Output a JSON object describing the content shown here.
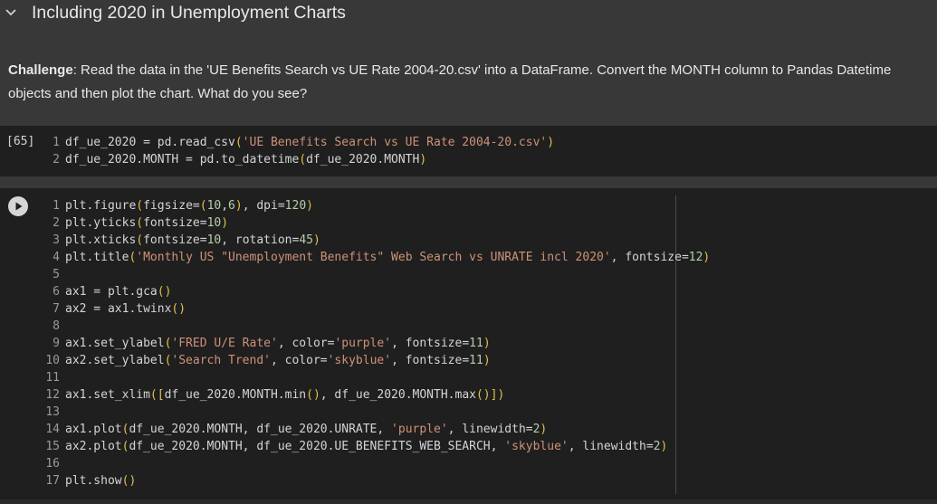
{
  "section": {
    "title": "Including 2020 in Unemployment Charts"
  },
  "markdown": {
    "bold": "Challenge",
    "text": ": Read the data in the 'UE Benefits Search vs UE Rate 2004-20.csv' into a DataFrame. Convert the MONTH column to Pandas Datetime objects and then plot the chart. What do you see?"
  },
  "cell1": {
    "execution_count": "[65]",
    "lines": [
      "df_ue_2020 = pd.read_csv('UE Benefits Search vs UE Rate 2004-20.csv')",
      "df_ue_2020.MONTH = pd.to_datetime(df_ue_2020.MONTH)"
    ]
  },
  "cell2": {
    "lines": [
      "plt.figure(figsize=(10,6), dpi=120)",
      "plt.yticks(fontsize=10)",
      "plt.xticks(fontsize=10, rotation=45)",
      "plt.title('Monthly US \"Unemployment Benefits\" Web Search vs UNRATE incl 2020', fontsize=12)",
      "",
      "ax1 = plt.gca()",
      "ax2 = ax1.twinx()",
      "",
      "ax1.set_ylabel('FRED U/E Rate', color='purple', fontsize=11)",
      "ax2.set_ylabel('Search Trend', color='skyblue', fontsize=11)",
      "",
      "ax1.set_xlim([df_ue_2020.MONTH.min(), df_ue_2020.MONTH.max()])",
      "",
      "ax1.plot(df_ue_2020.MONTH, df_ue_2020.UNRATE, 'purple', linewidth=2)",
      "ax2.plot(df_ue_2020.MONTH, df_ue_2020.UE_BENEFITS_WEB_SEARCH, 'skyblue', linewidth=2)",
      "",
      "plt.show()"
    ]
  },
  "icons": {
    "collapse": "chevron-down-icon",
    "run": "play-icon"
  },
  "colors": {
    "background": "#383838",
    "code_background": "#1f1f1f",
    "string": "#ce9178",
    "number": "#b5cea8",
    "bracket": "#e0c04c"
  }
}
